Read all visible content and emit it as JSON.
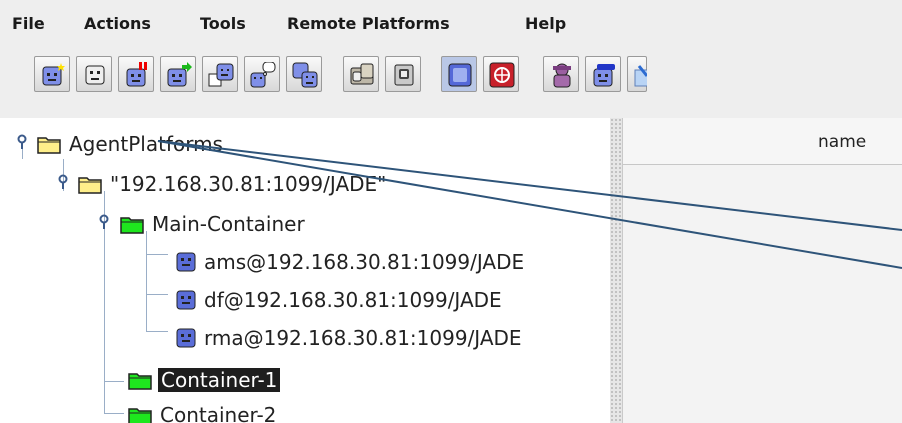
{
  "menu": [
    "File",
    "Actions",
    "Tools",
    "Remote Platforms",
    "Help"
  ],
  "toolbar_icons": [
    "new-agent-icon",
    "agent-face-icon",
    "kill-agent-icon",
    "migrate-agent-icon",
    "send-message-icon",
    "agent-thinking-icon",
    "clone-agent-icon",
    "sniffer-icon",
    "introspector-icon",
    "gui-icon",
    "exit-icon",
    "dummy-agent-icon",
    "log-agent-icon",
    "df-gui-icon"
  ],
  "tree": {
    "root": "AgentPlatforms",
    "platform": "\"192.168.30.81:1099/JADE\"",
    "main_container": "Main-Container",
    "agents": [
      "ams@192.168.30.81:1099/JADE",
      "df@192.168.30.81:1099/JADE",
      "rma@192.168.30.81:1099/JADE"
    ],
    "container1": "Container-1",
    "container2": "Container-2"
  },
  "table": {
    "column": "name"
  },
  "colors": {
    "selection_bg": "#1e1e1e",
    "folder_yellow": "#ffef8a",
    "folder_green": "#1ee61e",
    "agent_blue": "#5a6dd8",
    "annotation_line": "#2e5479"
  }
}
